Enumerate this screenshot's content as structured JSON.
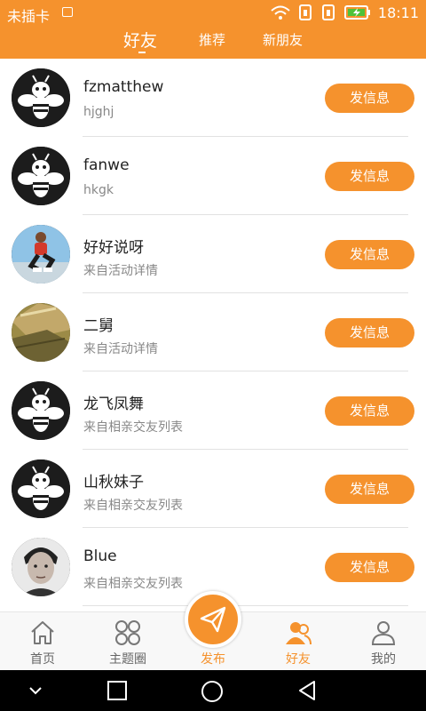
{
  "status_bar": {
    "carrier": "未插卡",
    "time": "18:11"
  },
  "header": {
    "tabs": [
      {
        "label": "好友",
        "active": true
      },
      {
        "label": "推荐",
        "active": false
      },
      {
        "label": "新朋友",
        "active": false
      }
    ]
  },
  "friends": [
    {
      "name": "fzmatthew",
      "subtitle": "hjghj",
      "button": "发信息",
      "avatar": "bee-logo-avatar"
    },
    {
      "name": "fanwe",
      "subtitle": "hkgk",
      "button": "发信息",
      "avatar": "bee-logo-avatar"
    },
    {
      "name": "好好说呀",
      "subtitle": "来自活动详情",
      "button": "发信息",
      "avatar": "jumping-person-photo"
    },
    {
      "name": "二舅",
      "subtitle": "来自活动详情",
      "button": "发信息",
      "avatar": "landscape-photo"
    },
    {
      "name": "龙飞凤舞",
      "subtitle": "来自相亲交友列表",
      "button": "发信息",
      "avatar": "bee-logo-avatar"
    },
    {
      "name": "山秋妹子",
      "subtitle": "来自相亲交友列表",
      "button": "发信息",
      "avatar": "bee-logo-avatar"
    },
    {
      "name": "Blue",
      "subtitle": "来自相亲交友列表",
      "button": "发信息",
      "avatar": "man-portrait-photo"
    }
  ],
  "bottom_nav": {
    "items": [
      {
        "label": "首页",
        "icon": "home-icon",
        "active": false
      },
      {
        "label": "主题圈",
        "icon": "grid-icon",
        "active": false
      },
      {
        "label": "发布",
        "icon": "paper-plane-icon",
        "active": true
      },
      {
        "label": "好友",
        "icon": "friends-icon",
        "active": true
      },
      {
        "label": "我的",
        "icon": "user-icon",
        "active": false
      }
    ]
  },
  "colors": {
    "accent": "#f5922d",
    "text_primary": "#222222",
    "text_secondary": "#888888"
  }
}
